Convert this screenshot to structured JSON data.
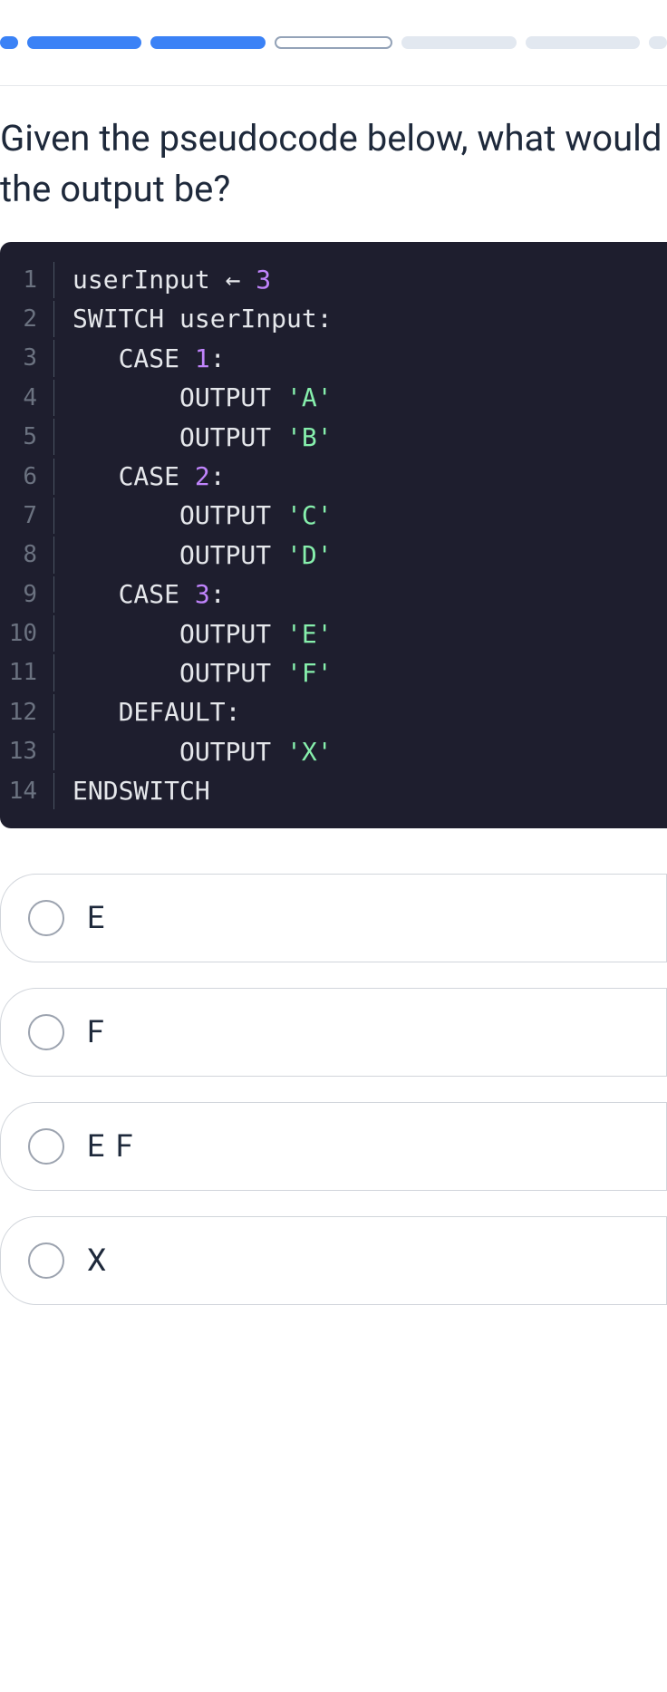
{
  "question": "Given the pseudocode below, what would the output be?",
  "code": {
    "lines": [
      {
        "n": "1",
        "tokens": [
          {
            "t": "userInput ",
            "c": "kw"
          },
          {
            "t": "←",
            "c": "kw"
          },
          {
            "t": " ",
            "c": "kw"
          },
          {
            "t": "3",
            "c": "num"
          }
        ]
      },
      {
        "n": "2",
        "tokens": [
          {
            "t": "SWITCH userInput:",
            "c": "kw"
          }
        ]
      },
      {
        "n": "3",
        "tokens": [
          {
            "t": "   CASE ",
            "c": "kw"
          },
          {
            "t": "1",
            "c": "num"
          },
          {
            "t": ":",
            "c": "kw"
          }
        ]
      },
      {
        "n": "4",
        "tokens": [
          {
            "t": "       OUTPUT ",
            "c": "kw"
          },
          {
            "t": "'A'",
            "c": "str"
          }
        ]
      },
      {
        "n": "5",
        "tokens": [
          {
            "t": "       OUTPUT ",
            "c": "kw"
          },
          {
            "t": "'B'",
            "c": "str"
          }
        ]
      },
      {
        "n": "6",
        "tokens": [
          {
            "t": "   CASE ",
            "c": "kw"
          },
          {
            "t": "2",
            "c": "num"
          },
          {
            "t": ":",
            "c": "kw"
          }
        ]
      },
      {
        "n": "7",
        "tokens": [
          {
            "t": "       OUTPUT ",
            "c": "kw"
          },
          {
            "t": "'C'",
            "c": "str"
          }
        ]
      },
      {
        "n": "8",
        "tokens": [
          {
            "t": "       OUTPUT ",
            "c": "kw"
          },
          {
            "t": "'D'",
            "c": "str"
          }
        ]
      },
      {
        "n": "9",
        "tokens": [
          {
            "t": "   CASE ",
            "c": "kw"
          },
          {
            "t": "3",
            "c": "num"
          },
          {
            "t": ":",
            "c": "kw"
          }
        ]
      },
      {
        "n": "10",
        "tokens": [
          {
            "t": "       OUTPUT ",
            "c": "kw"
          },
          {
            "t": "'E'",
            "c": "str"
          }
        ]
      },
      {
        "n": "11",
        "tokens": [
          {
            "t": "       OUTPUT ",
            "c": "kw"
          },
          {
            "t": "'F'",
            "c": "str"
          }
        ]
      },
      {
        "n": "12",
        "tokens": [
          {
            "t": "   DEFAULT:",
            "c": "kw"
          }
        ]
      },
      {
        "n": "13",
        "tokens": [
          {
            "t": "       OUTPUT ",
            "c": "kw"
          },
          {
            "t": "'X'",
            "c": "str"
          }
        ]
      },
      {
        "n": "14",
        "tokens": [
          {
            "t": "ENDSWITCH",
            "c": "kw"
          }
        ]
      }
    ]
  },
  "options": [
    "E",
    "F",
    "E F",
    "X"
  ]
}
